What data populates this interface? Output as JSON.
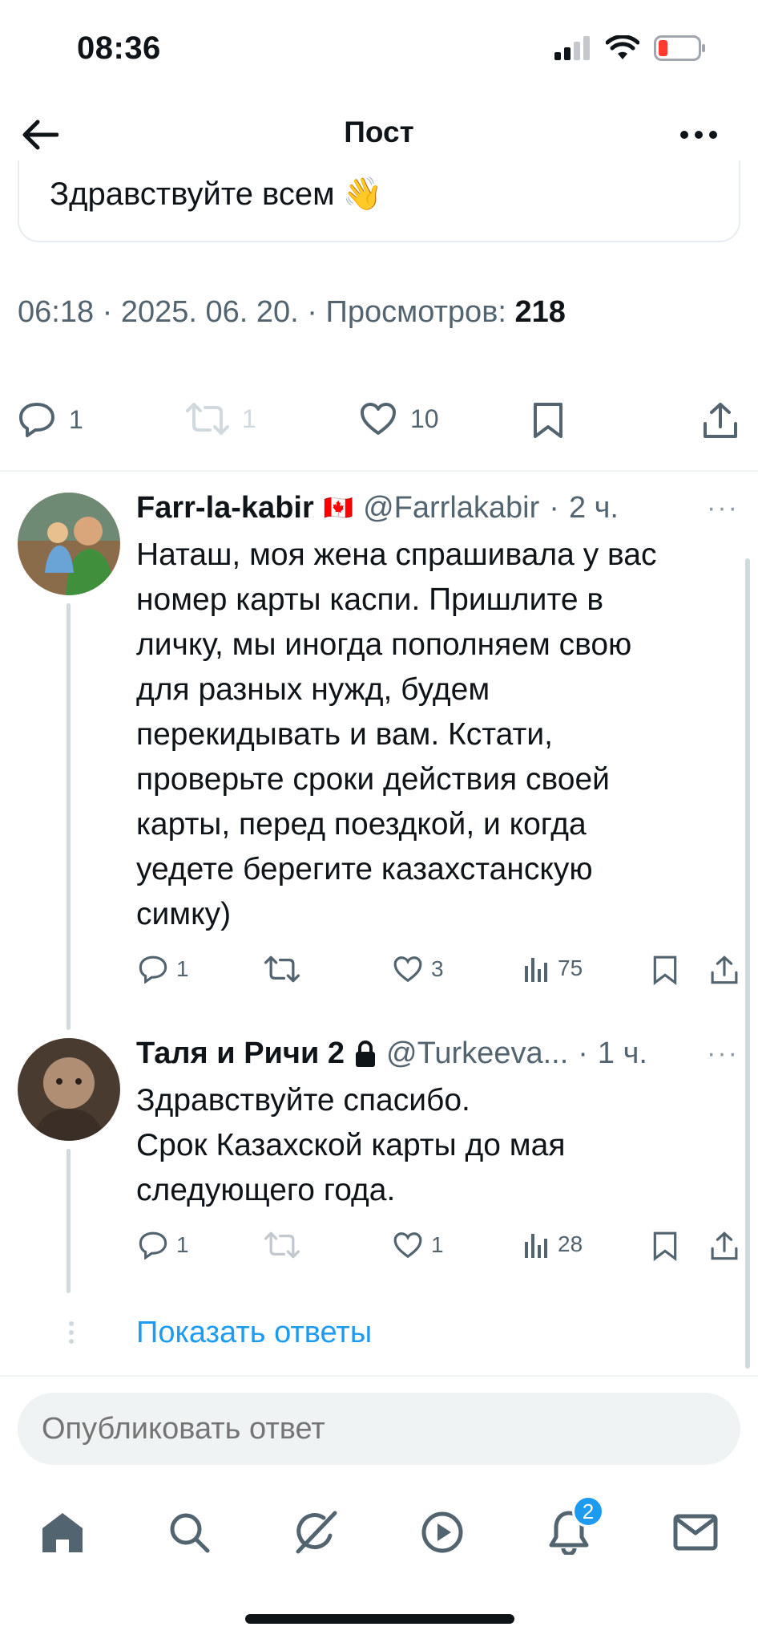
{
  "status_bar": {
    "time": "08:36"
  },
  "header": {
    "title": "Пост"
  },
  "quoted_post": {
    "text": "Здравствуйте всем",
    "emoji": "👋"
  },
  "post_meta": {
    "time": "06:18",
    "date": "2025. 06. 20.",
    "views_label": "Просмотров:",
    "views_count": "218"
  },
  "post_actions": {
    "replies": "1",
    "reposts": "1",
    "likes": "10"
  },
  "replies": [
    {
      "name": "Farr-la-kabir",
      "flag": "🇨🇦",
      "handle": "@Farrlakabir",
      "time": "2 ч.",
      "lines": [
        "Наташ, моя жена спрашивала у вас",
        "номер карты каспи. Пришлите в",
        "личку, мы иногда пополняем свою",
        "для разных нужд, будем",
        "перекидывать и вам. Кстати,",
        "проверьте сроки действия своей",
        "карты, перед поездкой, и когда",
        "уедете берегите казахстанскую",
        "симку)"
      ],
      "replies_count": "1",
      "likes": "3",
      "views": "75"
    },
    {
      "name": "Таля и Ричи 2",
      "handle": "@Turkeeva...",
      "time": "1 ч.",
      "lines": [
        "Здравствуйте спасибо.",
        "Срок Казахской карты до мая",
        "следующего года."
      ],
      "replies_count": "1",
      "likes": "1",
      "views": "28"
    }
  ],
  "show_replies": "Показать ответы",
  "compose": {
    "placeholder": "Опубликовать ответ"
  },
  "nav": {
    "notifications_badge": "2"
  },
  "colors": {
    "accent": "#1d9bf0",
    "text": "#0f1419",
    "muted": "#536471",
    "border": "#eff3f4"
  },
  "icons": [
    "back-arrow-icon",
    "more-icon",
    "reply-icon",
    "repost-icon",
    "like-icon",
    "bookmark-icon",
    "share-icon",
    "views-icon",
    "lock-icon",
    "home-icon",
    "search-icon",
    "grok-icon",
    "video-icon",
    "bell-icon",
    "mail-icon"
  ]
}
